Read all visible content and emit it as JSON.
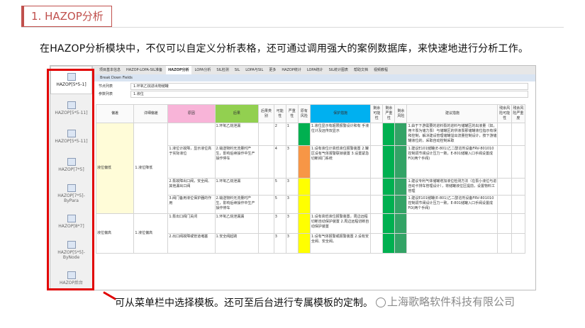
{
  "section_title": "1. HAZOP分析",
  "intro_text": "在HAZOP分析模块中，不仅可以自定义分析表格，还可通过调用强大的案例数据库，来快速地进行分析工作。",
  "caption_text": "可从菜单栏中选择模板。还可至后台进行专属模板的定制。",
  "watermark_text": "上海歌略软件科技有限公司",
  "sidebar": {
    "items": [
      {
        "label": "HAZOP[5*5-1]",
        "active": true
      },
      {
        "label": "HAZOP[5*5-11]"
      },
      {
        "label": "HAZOP[5*5-11]"
      },
      {
        "label": "HAZOP[7*5]"
      },
      {
        "label": "HAZOP[7*5]-ByPara"
      },
      {
        "label": "HAZOP[8*7]"
      },
      {
        "label": "HAZOP[5*5]-ByNode"
      },
      {
        "label": "HAZOP后台"
      },
      {
        "label": "Ana Node Mod"
      }
    ]
  },
  "tabs": [
    "项目基本信息",
    "HAZOP-LOPA-SIL准备",
    "HAZOP分析",
    "LOPA分析",
    "SIL检测",
    "SIL",
    "LOPA与SIL",
    "更多",
    "HAZOP统计",
    "LOPA统计",
    "SIL统计图表",
    "帮助文档",
    "视频教程"
  ],
  "breadcrumb": "Break Down Fields",
  "fields": {
    "node_label": "节点列表",
    "node_value": "1.环氧乙烷进出物储罐",
    "param_label": "参数列表",
    "param_value": "1.液位"
  },
  "table": {
    "headers": [
      "偏差",
      "详细偏差",
      "原因",
      "后果",
      "后果类别",
      "可能性",
      "严重性",
      "原有风险",
      "保护措施",
      "剩余可能性",
      "剩余严重性",
      "剩余风险",
      "建议措施",
      "残余风险可能性",
      "残余风险严重度"
    ],
    "rows": [
      {
        "dev": "液位偏低",
        "detail": "1.液位降低",
        "cause": "",
        "cons": "1.环氧乙烷泄漏",
        "cat": "",
        "l": "2",
        "s": "1",
        "protect": "1.液位显示有超限报警设计和有 手液位计及远传双显示",
        "advice": "1.由于下游需要的进料泵的进料与储罐区的出液量（如，用卡泵为储力泵）与储罐区的供液泵那储罐液位指示有误和控制，解决建设管理储罐溢出流量控制设计，按下游储罐液位的，采取自动控制采取"
      },
      {
        "dev": "",
        "detail": "",
        "cause": "1.液位计故障，显示液位高于实际液位",
        "cons": "2.输送物料无流量时产生，影响后续操作中生产操作停车",
        "cat": "",
        "l": "4",
        "s": "3",
        "protect": "1.设有液位计高低液位报警装置\n2.罐区设有气体报警联锁装置\n3.设置紧急切断阀门系统",
        "advice": "1.建议E101储罐(E-801)乙二醇溶剂设备FRV-801010控制调节阀设计压力一致，E-801储罐入口手阀设置成FO(两个手阀)"
      },
      {
        "dev": "",
        "detail": "",
        "cause": "2.泵故障出口阀，安全阀、其他漏出口阀",
        "cons": "1.环氧乙烷泄漏",
        "cat": "",
        "l": "5",
        "s": "3",
        "protect": "",
        "advice": "1.建议专利气体储罐增加液位检测方法（在泵小液位与进自动卡排车管理设计），将储罐液位区提前，设置物料工管理"
      },
      {
        "dev": "",
        "detail": "",
        "cause": "3.阀门备用液位保护器的作用",
        "cons": "2.输送物料无流量时产生，影响后续操作中生产操作停车",
        "cat": "",
        "l": "5",
        "s": "3",
        "protect": "",
        "advice": "1.建议E101储罐(E-801)乙二醇溶剂设备FRV-801010控制调节阀设计压力一致，E-801储罐入口手阀设置成FO(两个手阀)"
      },
      {
        "dev": "液位偏高",
        "detail": "1.液位偏高",
        "cause": "1.泵出口阀门关闭",
        "cons": "1.环氧乙烷泄漏漏",
        "cat": "",
        "l": "3",
        "s": "3",
        "protect": "1.设有高低液位报警装置，周边远程切断自动保护装置\n2.周边远程切断自动保护装置",
        "advice": ""
      },
      {
        "dev": "",
        "detail": "",
        "cause": "2.出口阀故障或管道堵塞",
        "cons": "1.安全阀起跳",
        "cat": "",
        "l": "3",
        "s": "3",
        "protect": "1.设有气体报警或报警装置\n2.设有安全阀、安全阀。",
        "advice": ""
      }
    ]
  },
  "colors": {
    "accent": "#c0504d",
    "frame": "#e10000",
    "cause_header": "#f8b4d8",
    "consequence_header": "#92d050",
    "safeguard_header": "#00b0f0"
  }
}
